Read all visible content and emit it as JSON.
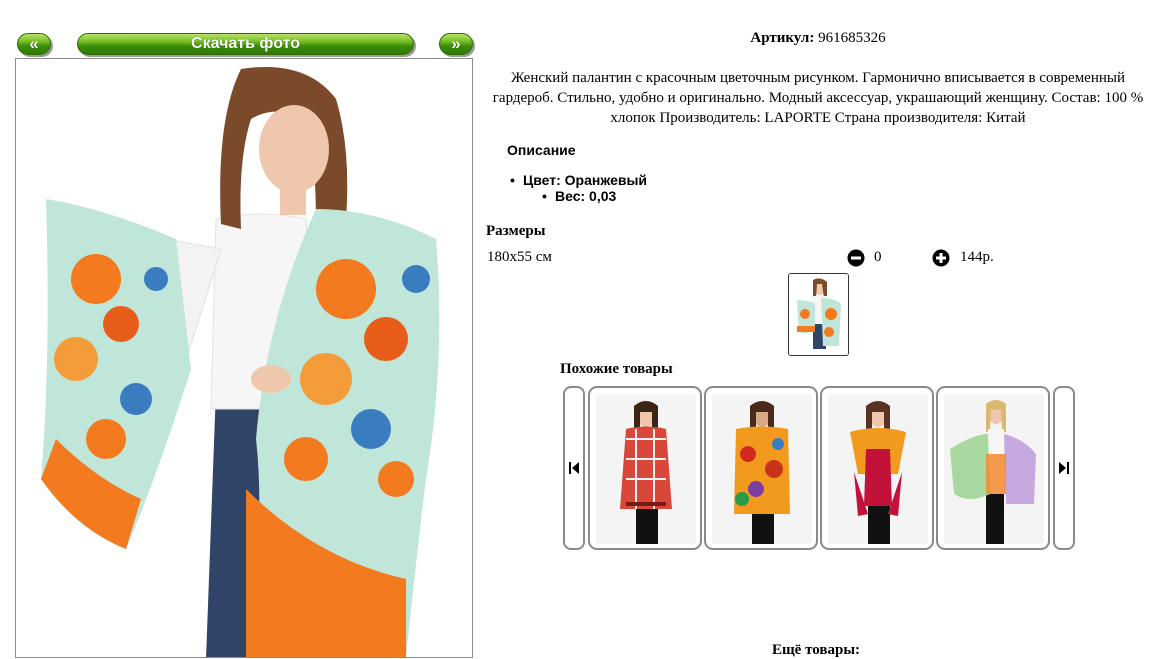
{
  "gallery": {
    "prev_label": "«",
    "download_label": "Скачать фото",
    "next_label": "»"
  },
  "product": {
    "article_label": "Артикул:",
    "article_value": "961685326",
    "description": "Женский палантин с красочным цветочным рисунком. Гармонично вписывается в современный гардероб. Стильно, удобно и оригинально. Модный аксессуар, украшающий женщину. Состав: 100 % хлопок Производитель: LAPORTE Страна производителя: Китай"
  },
  "details": {
    "title": "Описание",
    "items": [
      "Цвет: Оранжевый",
      "Вес: 0,03"
    ]
  },
  "sizes": {
    "title": "Размеры",
    "rows": [
      {
        "size": "180x55 см",
        "quantity": "0",
        "price": "144р."
      }
    ]
  },
  "similar": {
    "title": "Похожие товары"
  },
  "more": {
    "title": "Ещё товары:"
  },
  "colors": {
    "button_green": "#4f9d14",
    "scarf_orange": "#f47a1f",
    "scarf_mint": "#bfe6d9",
    "frame_border": "#8c8c8c"
  }
}
